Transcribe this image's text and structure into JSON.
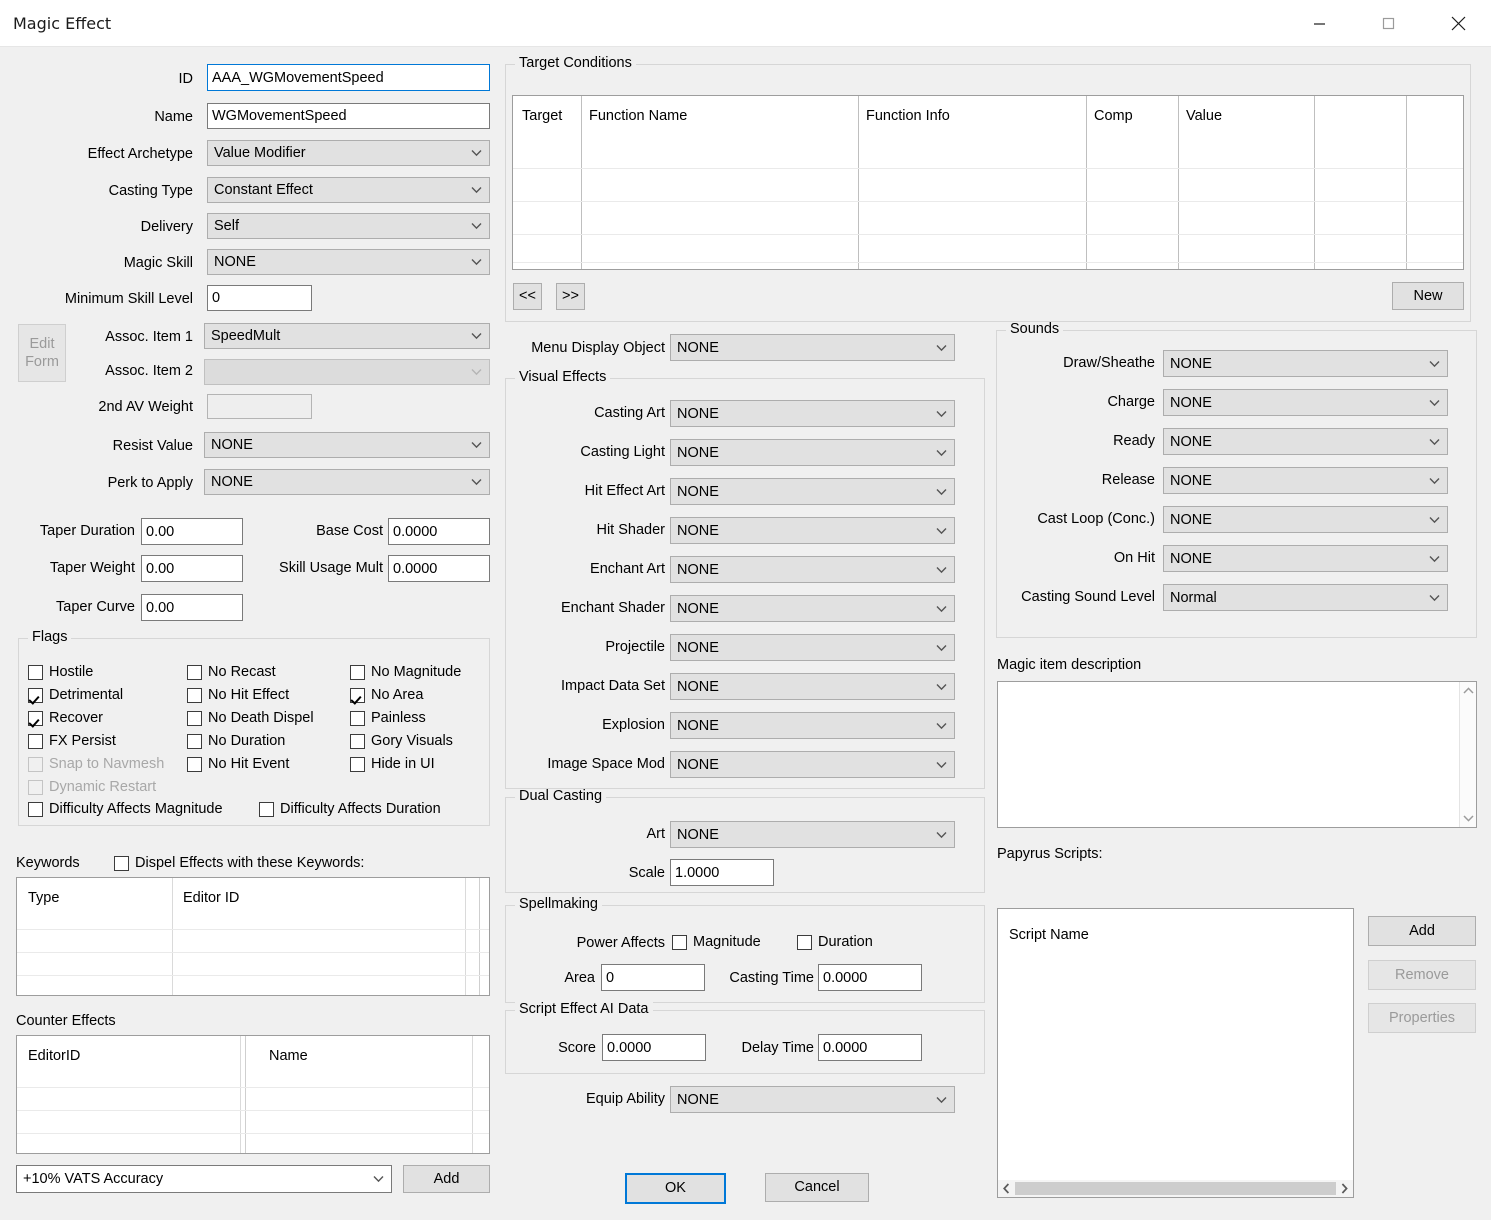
{
  "window": {
    "title": "Magic Effect",
    "minimize_label": "minimize",
    "maximize_label": "maximize",
    "close_label": "close"
  },
  "left_panel": {
    "fields": [
      {
        "label": "ID",
        "value": "AAA_WGMovementSpeed"
      },
      {
        "label": "Name",
        "value": "WGMovementSpeed"
      },
      {
        "label": "Effect Archetype",
        "value": "Value Modifier"
      },
      {
        "label": "Casting Type",
        "value": "Constant Effect"
      },
      {
        "label": "Delivery",
        "value": "Self"
      },
      {
        "label": "Magic Skill",
        "value": "NONE"
      },
      {
        "label": "Minimum Skill Level",
        "value": "0"
      },
      {
        "label": "Assoc. Item 1",
        "value": "SpeedMult"
      },
      {
        "label": "Assoc. Item 2",
        "value": ""
      },
      {
        "label": "2nd AV Weight",
        "value": ""
      },
      {
        "label": "Resist Value",
        "value": "NONE"
      },
      {
        "label": "Perk to Apply",
        "value": "NONE"
      }
    ],
    "edit_form_button": "Edit\nForm",
    "edit_form_line1": "Edit",
    "edit_form_line2": "Form",
    "taper": [
      {
        "label": "Taper Duration",
        "value": "0.00"
      },
      {
        "label": "Taper Weight",
        "value": "0.00"
      },
      {
        "label": "Taper Curve",
        "value": "0.00"
      }
    ],
    "cost": [
      {
        "label": "Base Cost",
        "value": "0.0000"
      },
      {
        "label": "Skill Usage Mult",
        "value": "0.0000"
      }
    ]
  },
  "flags": {
    "title": "Flags",
    "col1": [
      {
        "label": "Hostile",
        "checked": false,
        "disabled": false
      },
      {
        "label": "Detrimental",
        "checked": true,
        "disabled": false
      },
      {
        "label": "Recover",
        "checked": true,
        "disabled": false
      },
      {
        "label": "FX Persist",
        "checked": false,
        "disabled": false
      },
      {
        "label": "Snap to Navmesh",
        "checked": false,
        "disabled": true
      },
      {
        "label": "Dynamic Restart",
        "checked": false,
        "disabled": true
      }
    ],
    "col2": [
      {
        "label": "No Recast",
        "checked": false,
        "disabled": false
      },
      {
        "label": "No Hit Effect",
        "checked": false,
        "disabled": false
      },
      {
        "label": "No Death Dispel",
        "checked": false,
        "disabled": false
      },
      {
        "label": "No Duration",
        "checked": false,
        "disabled": false
      },
      {
        "label": "No Hit Event",
        "checked": false,
        "disabled": false
      }
    ],
    "col3": [
      {
        "label": "No Magnitude",
        "checked": false,
        "disabled": false
      },
      {
        "label": "No Area",
        "checked": true,
        "disabled": false
      },
      {
        "label": "Painless",
        "checked": false,
        "disabled": false
      },
      {
        "label": "Gory Visuals",
        "checked": false,
        "disabled": false
      },
      {
        "label": "Hide in UI",
        "checked": false,
        "disabled": false
      }
    ],
    "bottom": [
      {
        "label": "Difficulty Affects Magnitude",
        "checked": false,
        "disabled": false
      },
      {
        "label": "Difficulty Affects Duration",
        "checked": false,
        "disabled": false
      }
    ]
  },
  "keywords": {
    "title": "Keywords",
    "dispel_checkbox": "Dispel Effects with these Keywords:",
    "dispel_checked": false,
    "columns": [
      "Type",
      "Editor ID"
    ],
    "rows": []
  },
  "counter_effects": {
    "title": "Counter Effects",
    "columns": [
      "EditorID",
      "Name"
    ],
    "rows": [],
    "selector_value": "+10% VATS Accuracy",
    "add_button": "Add"
  },
  "target_conditions": {
    "title": "Target Conditions",
    "columns": [
      "Target",
      "Function Name",
      "Function Info",
      "Comp",
      "Value",
      "",
      ""
    ],
    "rows": [],
    "prev_button": "<<",
    "next_button": ">>",
    "new_button": "New"
  },
  "menu_display_object": {
    "label": "Menu Display Object",
    "value": "NONE"
  },
  "visual_effects": {
    "title": "Visual Effects",
    "rows": [
      {
        "label": "Casting Art",
        "value": "NONE"
      },
      {
        "label": "Casting Light",
        "value": "NONE"
      },
      {
        "label": "Hit Effect Art",
        "value": "NONE"
      },
      {
        "label": "Hit Shader",
        "value": "NONE"
      },
      {
        "label": "Enchant Art",
        "value": "NONE"
      },
      {
        "label": "Enchant Shader",
        "value": "NONE"
      },
      {
        "label": "Projectile",
        "value": "NONE"
      },
      {
        "label": "Impact Data Set",
        "value": "NONE"
      },
      {
        "label": "Explosion",
        "value": "NONE"
      },
      {
        "label": "Image Space Mod",
        "value": "NONE"
      }
    ]
  },
  "dual_casting": {
    "title": "Dual Casting",
    "art_label": "Art",
    "art_value": "NONE",
    "scale_label": "Scale",
    "scale_value": "1.0000"
  },
  "spellmaking": {
    "title": "Spellmaking",
    "power_affects_label": "Power Affects",
    "magnitude_label": "Magnitude",
    "magnitude_checked": false,
    "duration_label": "Duration",
    "duration_checked": false,
    "area_label": "Area",
    "area_value": "0",
    "casting_time_label": "Casting Time",
    "casting_time_value": "0.0000"
  },
  "script_effect_ai": {
    "title": "Script Effect AI Data",
    "score_label": "Score",
    "score_value": "0.0000",
    "delay_time_label": "Delay Time",
    "delay_time_value": "0.0000"
  },
  "equip_ability": {
    "label": "Equip Ability",
    "value": "NONE"
  },
  "sounds": {
    "title": "Sounds",
    "rows": [
      {
        "label": "Draw/Sheathe",
        "value": "NONE"
      },
      {
        "label": "Charge",
        "value": "NONE"
      },
      {
        "label": "Ready",
        "value": "NONE"
      },
      {
        "label": "Release",
        "value": "NONE"
      },
      {
        "label": "Cast Loop (Conc.)",
        "value": "NONE"
      },
      {
        "label": "On Hit",
        "value": "NONE"
      },
      {
        "label": "Casting Sound Level",
        "value": "Normal"
      }
    ]
  },
  "magic_item_description": {
    "label": "Magic item description",
    "value": ""
  },
  "papyrus": {
    "label": "Papyrus Scripts:",
    "column": "Script Name",
    "rows": [],
    "add_button": "Add",
    "remove_button": "Remove",
    "properties_button": "Properties"
  },
  "footer": {
    "ok_button": "OK",
    "cancel_button": "Cancel"
  },
  "colors": {
    "accent": "#0078d7",
    "background": "#f0f0f0",
    "control": "#e1e1e1"
  }
}
